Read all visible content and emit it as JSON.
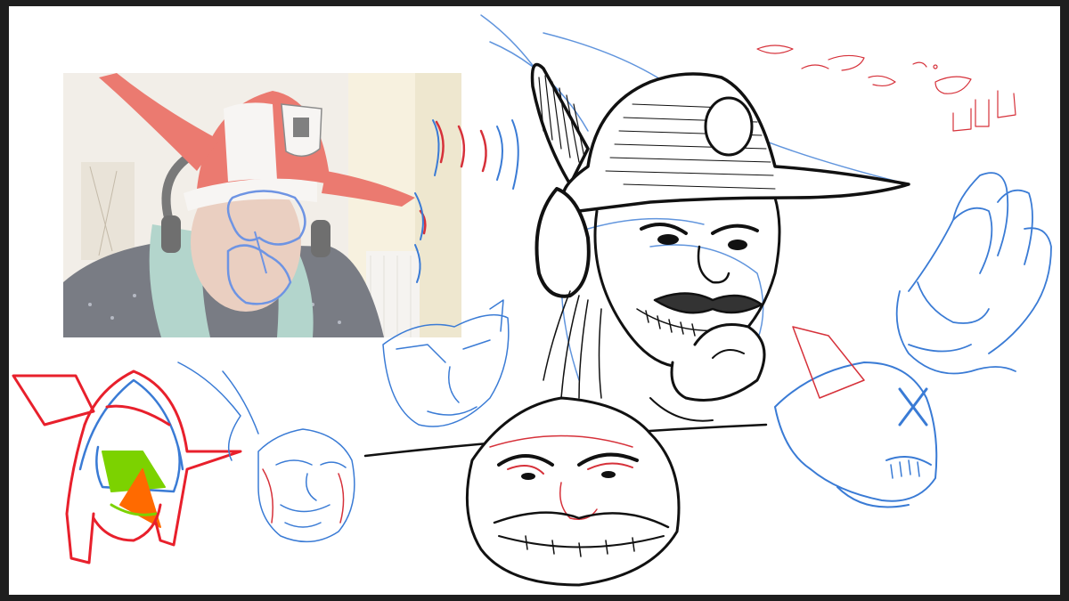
{
  "app": {
    "window_title": "",
    "background_color": "#1e1e1e",
    "canvas_color": "#ffffff"
  },
  "canvas": {
    "webcam_overlay": {
      "label": "",
      "icon": "webcam-feed"
    },
    "sketches": [
      {
        "name": "main-pirate-head",
        "colors": [
          "#111111",
          "#3a7bd5"
        ]
      },
      {
        "name": "lower-round-face",
        "colors": [
          "#111111",
          "#d6313a"
        ]
      },
      {
        "name": "red-horned-helmet",
        "colors": [
          "#e8202c",
          "#3a7bd5",
          "#7cd200",
          "#ff6a00"
        ]
      },
      {
        "name": "blue-old-man-face",
        "colors": [
          "#3a7bd5",
          "#d6313a"
        ]
      },
      {
        "name": "blue-angular-face",
        "colors": [
          "#3a7bd5"
        ]
      },
      {
        "name": "blue-skull",
        "colors": [
          "#3a7bd5",
          "#d6313a"
        ]
      },
      {
        "name": "blue-hand",
        "colors": [
          "#3a7bd5"
        ]
      },
      {
        "name": "red-lip-studies",
        "colors": [
          "#d6313a"
        ]
      }
    ]
  }
}
